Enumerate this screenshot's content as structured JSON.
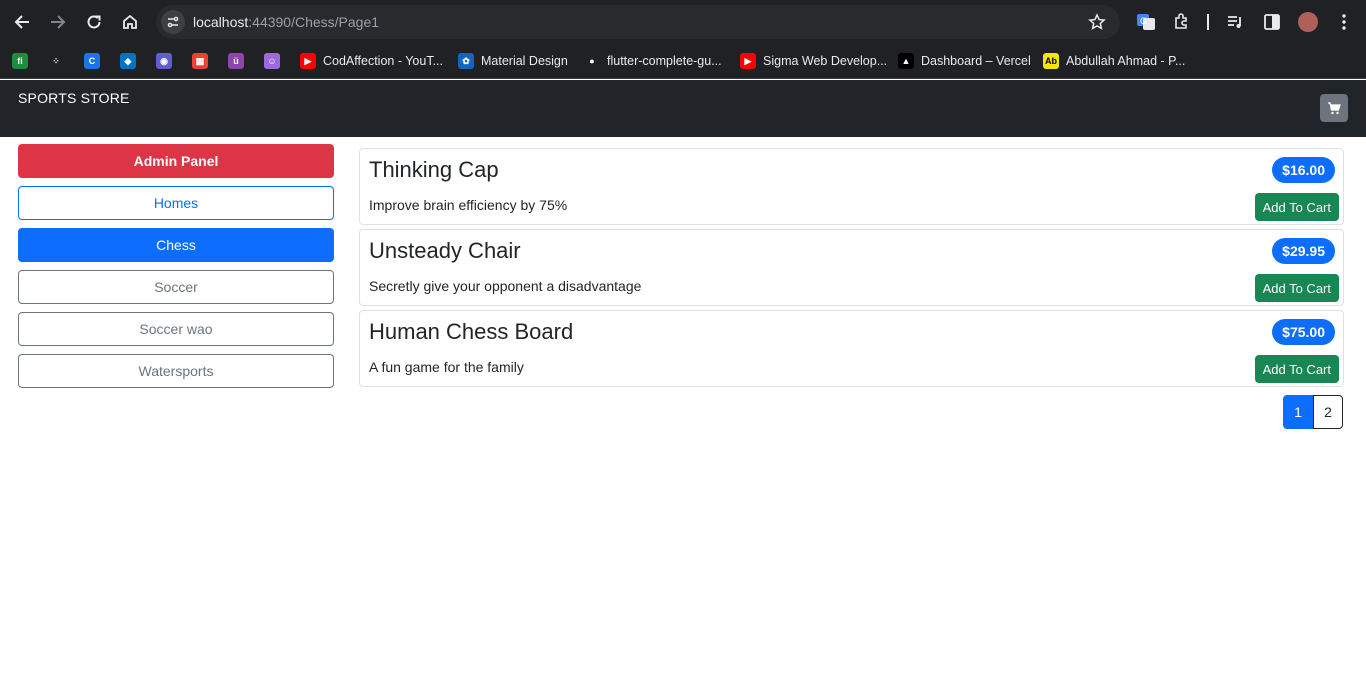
{
  "browser": {
    "url_host": "localhost",
    "url_path": ":44390/Chess/Page1",
    "bookmarks": [
      {
        "label": "",
        "icon": "fi-icon",
        "color": "#1e8e3e",
        "glyph": "fi"
      },
      {
        "label": "",
        "icon": "dots-icon",
        "color": "#202124",
        "glyph": "⁘"
      },
      {
        "label": "",
        "icon": "c-icon",
        "color": "#1a73e8",
        "glyph": "C"
      },
      {
        "label": "",
        "icon": "dart-icon",
        "color": "#0175c2",
        "glyph": "◆"
      },
      {
        "label": "",
        "icon": "eye-icon",
        "color": "#5f5fd0",
        "glyph": "◉"
      },
      {
        "label": "",
        "icon": "grid-icon",
        "color": "#ea4335",
        "glyph": "▦"
      },
      {
        "label": "",
        "icon": "u-icon",
        "color": "#8e44ad",
        "glyph": "ü"
      },
      {
        "label": "",
        "icon": "avatar-icon",
        "color": "#9c6ade",
        "glyph": "☺"
      },
      {
        "label": "CodAffection - YouT...",
        "icon": "youtube-icon",
        "color": "#ff0000",
        "glyph": "▶"
      },
      {
        "label": "Material Design",
        "icon": "material-icon",
        "color": "#1565c0",
        "glyph": "✿"
      },
      {
        "label": "flutter-complete-gu...",
        "icon": "github-icon",
        "color": "#202124",
        "glyph": "●"
      },
      {
        "label": "Sigma Web Develop...",
        "icon": "youtube-icon",
        "color": "#ff0000",
        "glyph": "▶"
      },
      {
        "label": "Dashboard – Vercel",
        "icon": "vercel-icon",
        "color": "#000000",
        "glyph": "▲"
      },
      {
        "label": "Abdullah Ahmad - P...",
        "icon": "ab-icon",
        "color": "#f5e60a",
        "glyph": "Ab"
      }
    ]
  },
  "navbar": {
    "brand": "SPORTS STORE",
    "cart_icon": "cart-icon"
  },
  "sidebar": {
    "admin_label": "Admin Panel",
    "categories": [
      {
        "label": "Homes",
        "style": "outline-primary"
      },
      {
        "label": "Chess",
        "style": "primary"
      },
      {
        "label": "Soccer",
        "style": "outline-secondary"
      },
      {
        "label": "Soccer wao",
        "style": "outline-secondary"
      },
      {
        "label": "Watersports",
        "style": "outline-secondary"
      }
    ]
  },
  "products": [
    {
      "name": "Thinking Cap",
      "price": "$16.00",
      "description": "Improve brain efficiency by 75%",
      "button": "Add To Cart"
    },
    {
      "name": "Unsteady Chair",
      "price": "$29.95",
      "description": "Secretly give your opponent a disadvantage",
      "button": "Add To Cart"
    },
    {
      "name": "Human Chess Board",
      "price": "$75.00",
      "description": "A fun game for the family",
      "button": "Add To Cart"
    }
  ],
  "pagination": {
    "pages": [
      "1",
      "2"
    ],
    "current": "1"
  },
  "colors": {
    "navbar_bg": "#212529",
    "danger": "#dc3545",
    "primary": "#0d6efd",
    "success": "#198754",
    "secondary": "#6c757d"
  }
}
